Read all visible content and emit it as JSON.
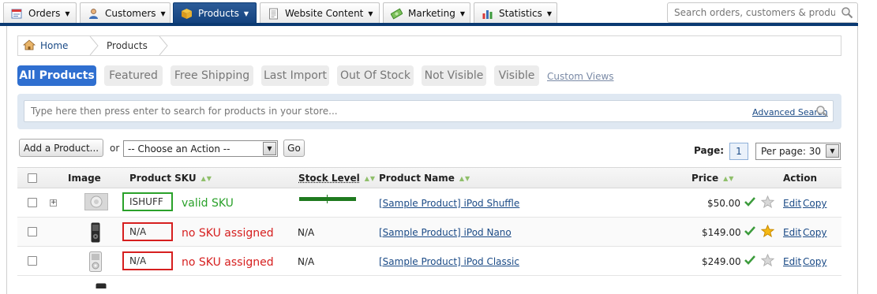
{
  "nav": {
    "tabs": [
      {
        "label": "Orders",
        "icon": "orders-icon"
      },
      {
        "label": "Customers",
        "icon": "customers-icon"
      },
      {
        "label": "Products",
        "icon": "products-box-icon",
        "active": true
      },
      {
        "label": "Website Content",
        "icon": "document-icon"
      },
      {
        "label": "Marketing",
        "icon": "money-icon"
      },
      {
        "label": "Statistics",
        "icon": "bar-chart-icon"
      }
    ],
    "search_placeholder": "Search orders, customers & products"
  },
  "breadcrumb": {
    "home": "Home",
    "current": "Products"
  },
  "filters": {
    "items": [
      "All Products",
      "Featured",
      "Free Shipping",
      "Last Import",
      "Out Of Stock",
      "Not Visible",
      "Visible"
    ],
    "active": "All Products",
    "custom_views": "Custom Views"
  },
  "search": {
    "placeholder": "Type here then press enter to search for products in your store...",
    "advanced": "Advanced Search"
  },
  "actions": {
    "add_product": "Add a Product...",
    "or": "or",
    "choose_action": "-- Choose an Action --",
    "go": "Go",
    "page_label": "Page:",
    "page_number": "1",
    "per_page": "Per page: 30"
  },
  "grid": {
    "columns": {
      "image": "Image",
      "sku": "Product SKU",
      "stock": "Stock Level",
      "name": "Product Name",
      "price": "Price",
      "action": "Action"
    },
    "rows": [
      {
        "sku": "ISHUFF",
        "sku_note": "valid SKU",
        "sku_status": "valid",
        "stock": "",
        "stock_fill": 1.0,
        "name": "[Sample Product] iPod Shuffle",
        "price": "$50.00",
        "featured": false,
        "edit": "Edit",
        "copy": "Copy"
      },
      {
        "sku": "N/A",
        "sku_note": "no SKU assigned",
        "sku_status": "missing",
        "stock": "N/A",
        "name": "[Sample Product] iPod Nano",
        "price": "$149.00",
        "featured": true,
        "edit": "Edit",
        "copy": "Copy"
      },
      {
        "sku": "N/A",
        "sku_note": "no SKU assigned",
        "sku_status": "missing",
        "stock": "N/A",
        "name": "[Sample Product] iPod Classic",
        "price": "$249.00",
        "featured": false,
        "edit": "Edit",
        "copy": "Copy"
      }
    ]
  },
  "colors": {
    "nav_active": "#13427d",
    "filter_active": "#2f6fd0",
    "valid_sku": "#2aa12a",
    "missing_sku": "#d61f1f",
    "stock_bar": "#1f7a1f",
    "link": "#1a4a86"
  }
}
